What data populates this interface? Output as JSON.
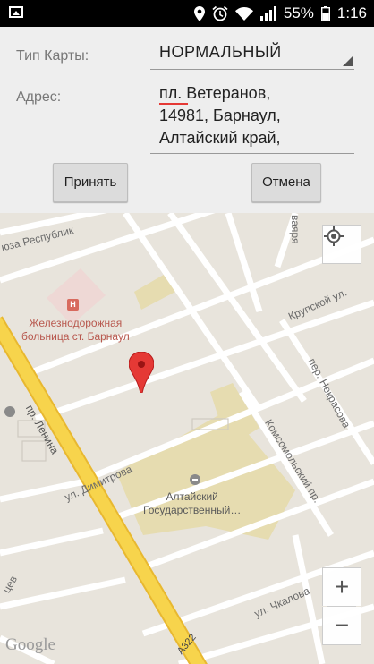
{
  "status_bar": {
    "battery_percent": "55%",
    "time": "1:16"
  },
  "form": {
    "map_type_label": "Тип Карты:",
    "map_type_value": "НОРМАЛЬНЫЙ",
    "address_label": "Адрес:",
    "address_value": "пл. Ветеранов,\n14981, Барнаул,\nАлтайский край,",
    "accept_button": "Принять",
    "cancel_button": "Отмена"
  },
  "map": {
    "labels": {
      "street_soyuza_respublik": "юза Республик",
      "street_lenina": "пр. Ленина",
      "street_dimitrova": "ул. Димитрова",
      "street_krupskoy": "Крупской ул.",
      "street_nekrasova": "пер. Некрасова",
      "street_komsomolsky": "Комсомольский пр.",
      "street_chkalova": "ул. Чкалова",
      "street_top": "ваяря",
      "street_left": "цев",
      "road_code": "А322",
      "hospital_line1": "Железнодорожная",
      "hospital_line2": "больница ст. Барнаул",
      "university_line1": "Алтайский",
      "university_line2": "Государственный…",
      "attribution": "Google"
    },
    "controls": {
      "locate": "my-location",
      "zoom_in": "+",
      "zoom_out": "−"
    },
    "colors": {
      "main_road": "#f7d44c",
      "main_road_edge": "#e8b830",
      "marker": "#e53935",
      "hospital_label": "#b8584e",
      "university_label": "#5a5a5a"
    }
  }
}
